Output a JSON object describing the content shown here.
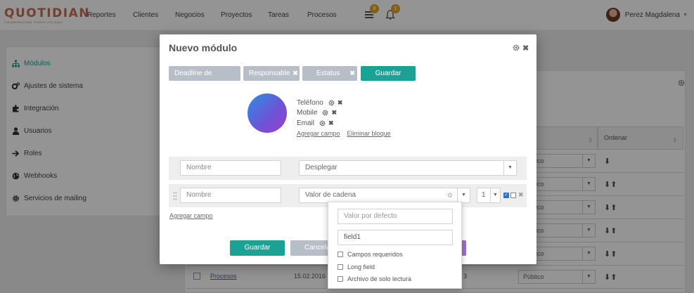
{
  "app": {
    "logo": "QUOTIDIAN",
    "logo_tagline": "COLABORACIÓN TODOS LOS DÍAS"
  },
  "nav": {
    "items": [
      "Reportes",
      "Clientes",
      "Negocios",
      "Proyectos",
      "Tareas",
      "Procesos"
    ],
    "messages_badge": "0",
    "notifications_badge": "1"
  },
  "user": {
    "name": "Perez Magdalena"
  },
  "sidebar": {
    "items": [
      {
        "label": "Módulos",
        "icon": "sitemap-icon",
        "active": true
      },
      {
        "label": "Ajustes de sistema",
        "icon": "cogs-icon"
      },
      {
        "label": "Integración",
        "icon": "puzzle-icon"
      },
      {
        "label": "Usuarios",
        "icon": "user-icon"
      },
      {
        "label": "Roles",
        "icon": "arrow-right-icon"
      },
      {
        "label": "Webhooks",
        "icon": "globe-icon"
      },
      {
        "label": "Servicios de mailing",
        "icon": "gear-icon"
      }
    ]
  },
  "background": {
    "col_partial": "s",
    "col_order": "Ordenar",
    "select_value": "Público",
    "last_row": {
      "link": "Procesos",
      "date": "15.02.2016 0",
      "extra": "3"
    }
  },
  "modal": {
    "title": "Nuevo módulo",
    "chips": [
      "Deadline de envío",
      "Responsable",
      "Estatus"
    ],
    "save_top": "Guardar",
    "block_fields": [
      "Teléfono",
      "Mobile",
      "Email"
    ],
    "add_field_link": "Agregar campo",
    "delete_block_link": "Eliminar bloque",
    "row1": {
      "name_placeholder": "Nombre",
      "type_value": "Desplegar"
    },
    "row2": {
      "name_placeholder": "Nombre",
      "type_value": "Valor de cadena",
      "count_value": "1"
    },
    "add_field_bottom": "Agregar campo",
    "save_bottom": "Guardar",
    "cancel": "Cancelar"
  },
  "popup": {
    "default_placeholder": "Valor por defecto",
    "field_name": "field1",
    "options": [
      "Campos requeridos",
      "Long field",
      "Archivo de solo lectura"
    ]
  },
  "colors": {
    "accent": "#1aa395",
    "chip": "#b8bec7",
    "logo": "#c5704f",
    "badge": "#e0a32e"
  }
}
